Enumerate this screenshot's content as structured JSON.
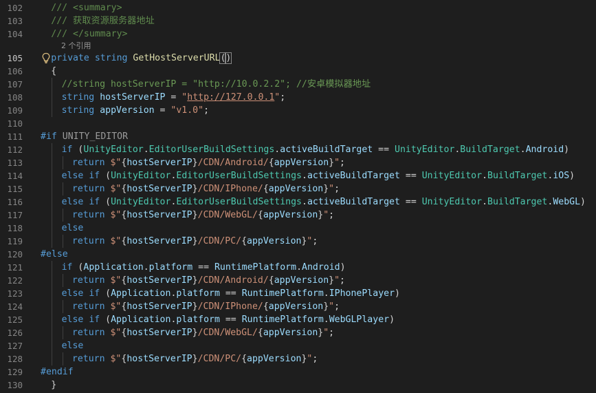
{
  "editor": {
    "lines": [
      {
        "n": "102",
        "indent": 2,
        "tokens": [
          [
            "doc",
            "/// <summary>"
          ]
        ]
      },
      {
        "n": "103",
        "indent": 2,
        "tokens": [
          [
            "doc",
            "/// 获取资源服务器地址"
          ]
        ]
      },
      {
        "n": "104",
        "indent": 2,
        "tokens": [
          [
            "doc",
            "/// </summary>"
          ]
        ]
      },
      {
        "codelens": "2 个引用"
      },
      {
        "n": "105",
        "indent": 2,
        "active": true,
        "lightbulb": true,
        "tokens": [
          [
            "kw",
            "private"
          ],
          [
            "pun",
            " "
          ],
          [
            "kw",
            "string"
          ],
          [
            "pun",
            " "
          ],
          [
            "fn",
            "GetHostServerURL"
          ],
          [
            "brk",
            "("
          ],
          [
            "brk",
            ")"
          ]
        ]
      },
      {
        "n": "106",
        "indent": 2,
        "tokens": [
          [
            "pun",
            "{"
          ]
        ]
      },
      {
        "n": "107",
        "indent": 4,
        "tokens": [
          [
            "com",
            "//string hostServerIP = \"http://10.0.2.2\"; //安卓模拟器地址"
          ]
        ]
      },
      {
        "n": "108",
        "indent": 4,
        "tokens": [
          [
            "kw",
            "string"
          ],
          [
            "pun",
            " "
          ],
          [
            "var",
            "hostServerIP"
          ],
          [
            "pun",
            " = "
          ],
          [
            "str",
            "\""
          ],
          [
            "url",
            "http://127.0.0.1"
          ],
          [
            "str",
            "\""
          ],
          [
            "pun",
            ";"
          ]
        ]
      },
      {
        "n": "109",
        "indent": 4,
        "tokens": [
          [
            "kw",
            "string"
          ],
          [
            "pun",
            " "
          ],
          [
            "var",
            "appVersion"
          ],
          [
            "pun",
            " = "
          ],
          [
            "str",
            "\"v1.0\""
          ],
          [
            "pun",
            ";"
          ]
        ]
      },
      {
        "n": "110",
        "indent": 0,
        "tokens": []
      },
      {
        "n": "111",
        "indent": 0,
        "tokens": [
          [
            "kw",
            "#if"
          ],
          [
            "pun",
            " "
          ],
          [
            "pre",
            "UNITY_EDITOR"
          ]
        ]
      },
      {
        "n": "112",
        "indent": 4,
        "tokens": [
          [
            "ctl",
            "if"
          ],
          [
            "pun",
            " ("
          ],
          [
            "type",
            "UnityEditor"
          ],
          [
            "pun",
            "."
          ],
          [
            "type",
            "EditorUserBuildSettings"
          ],
          [
            "pun",
            "."
          ],
          [
            "var",
            "activeBuildTarget"
          ],
          [
            "pun",
            " == "
          ],
          [
            "type",
            "UnityEditor"
          ],
          [
            "pun",
            "."
          ],
          [
            "type",
            "BuildTarget"
          ],
          [
            "pun",
            "."
          ],
          [
            "var",
            "Android"
          ],
          [
            "pun",
            ")"
          ]
        ]
      },
      {
        "n": "113",
        "indent": 6,
        "tokens": [
          [
            "ctl",
            "return"
          ],
          [
            "pun",
            " "
          ],
          [
            "str",
            "$\""
          ],
          [
            "pun",
            "{"
          ],
          [
            "var",
            "hostServerIP"
          ],
          [
            "pun",
            "}"
          ],
          [
            "str",
            "/CDN/Android/"
          ],
          [
            "pun",
            "{"
          ],
          [
            "var",
            "appVersion"
          ],
          [
            "pun",
            "}"
          ],
          [
            "str",
            "\""
          ],
          [
            "pun",
            ";"
          ]
        ]
      },
      {
        "n": "114",
        "indent": 4,
        "tokens": [
          [
            "ctl",
            "else"
          ],
          [
            "pun",
            " "
          ],
          [
            "ctl",
            "if"
          ],
          [
            "pun",
            " ("
          ],
          [
            "type",
            "UnityEditor"
          ],
          [
            "pun",
            "."
          ],
          [
            "type",
            "EditorUserBuildSettings"
          ],
          [
            "pun",
            "."
          ],
          [
            "var",
            "activeBuildTarget"
          ],
          [
            "pun",
            " == "
          ],
          [
            "type",
            "UnityEditor"
          ],
          [
            "pun",
            "."
          ],
          [
            "type",
            "BuildTarget"
          ],
          [
            "pun",
            "."
          ],
          [
            "var",
            "iOS"
          ],
          [
            "pun",
            ")"
          ]
        ]
      },
      {
        "n": "115",
        "indent": 6,
        "tokens": [
          [
            "ctl",
            "return"
          ],
          [
            "pun",
            " "
          ],
          [
            "str",
            "$\""
          ],
          [
            "pun",
            "{"
          ],
          [
            "var",
            "hostServerIP"
          ],
          [
            "pun",
            "}"
          ],
          [
            "str",
            "/CDN/IPhone/"
          ],
          [
            "pun",
            "{"
          ],
          [
            "var",
            "appVersion"
          ],
          [
            "pun",
            "}"
          ],
          [
            "str",
            "\""
          ],
          [
            "pun",
            ";"
          ]
        ]
      },
      {
        "n": "116",
        "indent": 4,
        "tokens": [
          [
            "ctl",
            "else"
          ],
          [
            "pun",
            " "
          ],
          [
            "ctl",
            "if"
          ],
          [
            "pun",
            " ("
          ],
          [
            "type",
            "UnityEditor"
          ],
          [
            "pun",
            "."
          ],
          [
            "type",
            "EditorUserBuildSettings"
          ],
          [
            "pun",
            "."
          ],
          [
            "var",
            "activeBuildTarget"
          ],
          [
            "pun",
            " == "
          ],
          [
            "type",
            "UnityEditor"
          ],
          [
            "pun",
            "."
          ],
          [
            "type",
            "BuildTarget"
          ],
          [
            "pun",
            "."
          ],
          [
            "var",
            "WebGL"
          ],
          [
            "pun",
            ")"
          ]
        ]
      },
      {
        "n": "117",
        "indent": 6,
        "tokens": [
          [
            "ctl",
            "return"
          ],
          [
            "pun",
            " "
          ],
          [
            "str",
            "$\""
          ],
          [
            "pun",
            "{"
          ],
          [
            "var",
            "hostServerIP"
          ],
          [
            "pun",
            "}"
          ],
          [
            "str",
            "/CDN/WebGL/"
          ],
          [
            "pun",
            "{"
          ],
          [
            "var",
            "appVersion"
          ],
          [
            "pun",
            "}"
          ],
          [
            "str",
            "\""
          ],
          [
            "pun",
            ";"
          ]
        ]
      },
      {
        "n": "118",
        "indent": 4,
        "tokens": [
          [
            "ctl",
            "else"
          ]
        ]
      },
      {
        "n": "119",
        "indent": 6,
        "tokens": [
          [
            "ctl",
            "return"
          ],
          [
            "pun",
            " "
          ],
          [
            "str",
            "$\""
          ],
          [
            "pun",
            "{"
          ],
          [
            "var",
            "hostServerIP"
          ],
          [
            "pun",
            "}"
          ],
          [
            "str",
            "/CDN/PC/"
          ],
          [
            "pun",
            "{"
          ],
          [
            "var",
            "appVersion"
          ],
          [
            "pun",
            "}"
          ],
          [
            "str",
            "\""
          ],
          [
            "pun",
            ";"
          ]
        ]
      },
      {
        "n": "120",
        "indent": 0,
        "tokens": [
          [
            "kw",
            "#else"
          ]
        ]
      },
      {
        "n": "121",
        "indent": 4,
        "tokens": [
          [
            "ctl",
            "if"
          ],
          [
            "pun",
            " ("
          ],
          [
            "var",
            "Application"
          ],
          [
            "pun",
            "."
          ],
          [
            "var",
            "platform"
          ],
          [
            "pun",
            " == "
          ],
          [
            "var",
            "RuntimePlatform"
          ],
          [
            "pun",
            "."
          ],
          [
            "var",
            "Android"
          ],
          [
            "pun",
            ")"
          ]
        ]
      },
      {
        "n": "122",
        "indent": 6,
        "tokens": [
          [
            "ctl",
            "return"
          ],
          [
            "pun",
            " "
          ],
          [
            "str",
            "$\""
          ],
          [
            "pun",
            "{"
          ],
          [
            "var",
            "hostServerIP"
          ],
          [
            "pun",
            "}"
          ],
          [
            "str",
            "/CDN/Android/"
          ],
          [
            "pun",
            "{"
          ],
          [
            "var",
            "appVersion"
          ],
          [
            "pun",
            "}"
          ],
          [
            "str",
            "\""
          ],
          [
            "pun",
            ";"
          ]
        ]
      },
      {
        "n": "123",
        "indent": 4,
        "tokens": [
          [
            "ctl",
            "else"
          ],
          [
            "pun",
            " "
          ],
          [
            "ctl",
            "if"
          ],
          [
            "pun",
            " ("
          ],
          [
            "var",
            "Application"
          ],
          [
            "pun",
            "."
          ],
          [
            "var",
            "platform"
          ],
          [
            "pun",
            " == "
          ],
          [
            "var",
            "RuntimePlatform"
          ],
          [
            "pun",
            "."
          ],
          [
            "var",
            "IPhonePlayer"
          ],
          [
            "pun",
            ")"
          ]
        ]
      },
      {
        "n": "124",
        "indent": 6,
        "tokens": [
          [
            "ctl",
            "return"
          ],
          [
            "pun",
            " "
          ],
          [
            "str",
            "$\""
          ],
          [
            "pun",
            "{"
          ],
          [
            "var",
            "hostServerIP"
          ],
          [
            "pun",
            "}"
          ],
          [
            "str",
            "/CDN/IPhone/"
          ],
          [
            "pun",
            "{"
          ],
          [
            "var",
            "appVersion"
          ],
          [
            "pun",
            "}"
          ],
          [
            "str",
            "\""
          ],
          [
            "pun",
            ";"
          ]
        ]
      },
      {
        "n": "125",
        "indent": 4,
        "tokens": [
          [
            "ctl",
            "else"
          ],
          [
            "pun",
            " "
          ],
          [
            "ctl",
            "if"
          ],
          [
            "pun",
            " ("
          ],
          [
            "var",
            "Application"
          ],
          [
            "pun",
            "."
          ],
          [
            "var",
            "platform"
          ],
          [
            "pun",
            " == "
          ],
          [
            "var",
            "RuntimePlatform"
          ],
          [
            "pun",
            "."
          ],
          [
            "var",
            "WebGLPlayer"
          ],
          [
            "pun",
            ")"
          ]
        ]
      },
      {
        "n": "126",
        "indent": 6,
        "tokens": [
          [
            "ctl",
            "return"
          ],
          [
            "pun",
            " "
          ],
          [
            "str",
            "$\""
          ],
          [
            "pun",
            "{"
          ],
          [
            "var",
            "hostServerIP"
          ],
          [
            "pun",
            "}"
          ],
          [
            "str",
            "/CDN/WebGL/"
          ],
          [
            "pun",
            "{"
          ],
          [
            "var",
            "appVersion"
          ],
          [
            "pun",
            "}"
          ],
          [
            "str",
            "\""
          ],
          [
            "pun",
            ";"
          ]
        ]
      },
      {
        "n": "127",
        "indent": 4,
        "tokens": [
          [
            "ctl",
            "else"
          ]
        ]
      },
      {
        "n": "128",
        "indent": 6,
        "tokens": [
          [
            "ctl",
            "return"
          ],
          [
            "pun",
            " "
          ],
          [
            "str",
            "$\""
          ],
          [
            "pun",
            "{"
          ],
          [
            "var",
            "hostServerIP"
          ],
          [
            "pun",
            "}"
          ],
          [
            "str",
            "/CDN/PC/"
          ],
          [
            "pun",
            "{"
          ],
          [
            "var",
            "appVersion"
          ],
          [
            "pun",
            "}"
          ],
          [
            "str",
            "\""
          ],
          [
            "pun",
            ";"
          ]
        ]
      },
      {
        "n": "129",
        "indent": 0,
        "tokens": [
          [
            "kw",
            "#endif"
          ]
        ]
      },
      {
        "n": "130",
        "indent": 2,
        "tokens": [
          [
            "pun",
            "}"
          ]
        ]
      }
    ]
  },
  "theme": {
    "background": "#1e1e1e",
    "line_number": "#858585",
    "active_line_number": "#c6c6c6",
    "comment": "#6a9955",
    "keyword": "#569cd6",
    "function": "#dcdcaa",
    "variable": "#9cdcfe",
    "string": "#ce9178",
    "type": "#4ec9b0"
  },
  "icons": {
    "lightbulb": "lightbulb-icon"
  }
}
